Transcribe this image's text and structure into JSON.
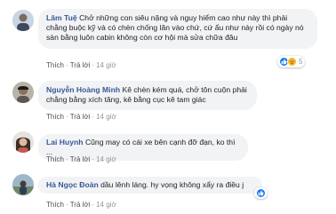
{
  "comments": [
    {
      "author": "Lâm Tuệ",
      "text": "Chở những con siêu nặng và nguy hiểm cao như này thì phải chằng buộc kỹ và có chèn chống lăn vào chứ, cứ ẩu như này rồi có ngày nó sàn bằng luôn cabin không còn cơ hội mà sửa chữa đâu",
      "like_label": "Thích",
      "reply_label": "Trả lời",
      "time": "14 giờ",
      "reactions": [
        "like",
        "angry"
      ],
      "reaction_count": "5"
    },
    {
      "author": "Nguyễn Hoàng Minh",
      "text": "Kê chèn kém quá, chở tôn cuộn phải chằng bằng xích tăng, kê bằng cục kê tam giác",
      "like_label": "Thích",
      "reply_label": "Trả lời",
      "time": "14 giờ"
    },
    {
      "author": "Lai Huynh",
      "text": "Cũng may có cái xe bên cạnh đỡ đạn, ko thì ...",
      "like_label": "Thích",
      "reply_label": "Trả lời",
      "time": "14 giờ"
    },
    {
      "author": "Hà Ngọc Đoàn",
      "text": "dầu lênh láng. hy vọng không xẩy ra điều j",
      "like_label": "Thích",
      "reply_label": "Trả lời",
      "time": "14 giờ",
      "reactions": [
        "like"
      ]
    }
  ],
  "colors": {
    "author": "#385898",
    "bubble": "#f2f3f5",
    "meta": "#90949c",
    "like": "#1877f2",
    "angry": "#f5b829"
  }
}
